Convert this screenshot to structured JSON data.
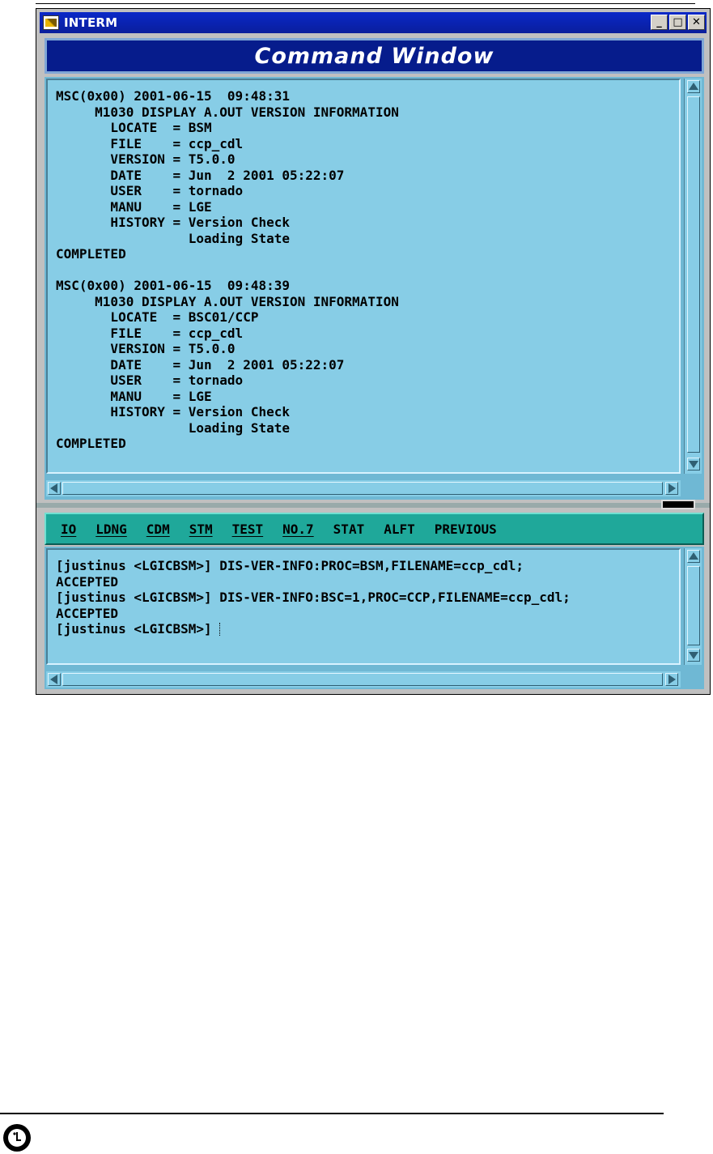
{
  "window": {
    "title": "INTERM",
    "buttons": {
      "minimize": "_",
      "maximize": "□",
      "close": "✕"
    },
    "header": "Command Window"
  },
  "output_lines": [
    "MSC(0x00) 2001-06-15  09:48:31",
    "     M1030 DISPLAY A.OUT VERSION INFORMATION",
    "       LOCATE  = BSM",
    "       FILE    = ccp_cdl",
    "       VERSION = T5.0.0",
    "       DATE    = Jun  2 2001 05:22:07",
    "       USER    = tornado",
    "       MANU    = LGE",
    "       HISTORY = Version Check",
    "                 Loading State",
    "COMPLETED",
    "",
    "MSC(0x00) 2001-06-15  09:48:39",
    "     M1030 DISPLAY A.OUT VERSION INFORMATION",
    "       LOCATE  = BSC01/CCP",
    "       FILE    = ccp_cdl",
    "       VERSION = T5.0.0",
    "       DATE    = Jun  2 2001 05:22:07",
    "       USER    = tornado",
    "       MANU    = LGE",
    "       HISTORY = Version Check",
    "                 Loading State",
    "COMPLETED"
  ],
  "menu": [
    {
      "label": "IO"
    },
    {
      "label": "LDNG"
    },
    {
      "label": "CDM"
    },
    {
      "label": "STM"
    },
    {
      "label": "TEST"
    },
    {
      "label": "NO.7"
    },
    {
      "label": "STAT"
    },
    {
      "label": "ALFT"
    },
    {
      "label": "PREVIOUS"
    }
  ],
  "console_lines": [
    "[justinus <LGICBSM>] DIS-VER-INFO:PROC=BSM,FILENAME=ccp_cdl;",
    "ACCEPTED",
    "[justinus <LGICBSM>] DIS-VER-INFO:BSC=1,PROC=CCP,FILENAME=ccp_cdl;",
    "ACCEPTED",
    "[justinus <LGICBSM>] "
  ],
  "icons": {
    "app": "interm-app-icon",
    "logo": "lg-logo-icon"
  },
  "colors": {
    "title_bar": "#0a28c8",
    "header": "#061c8c",
    "pane": "#87cde6",
    "menu_bar": "#1fa89a"
  }
}
